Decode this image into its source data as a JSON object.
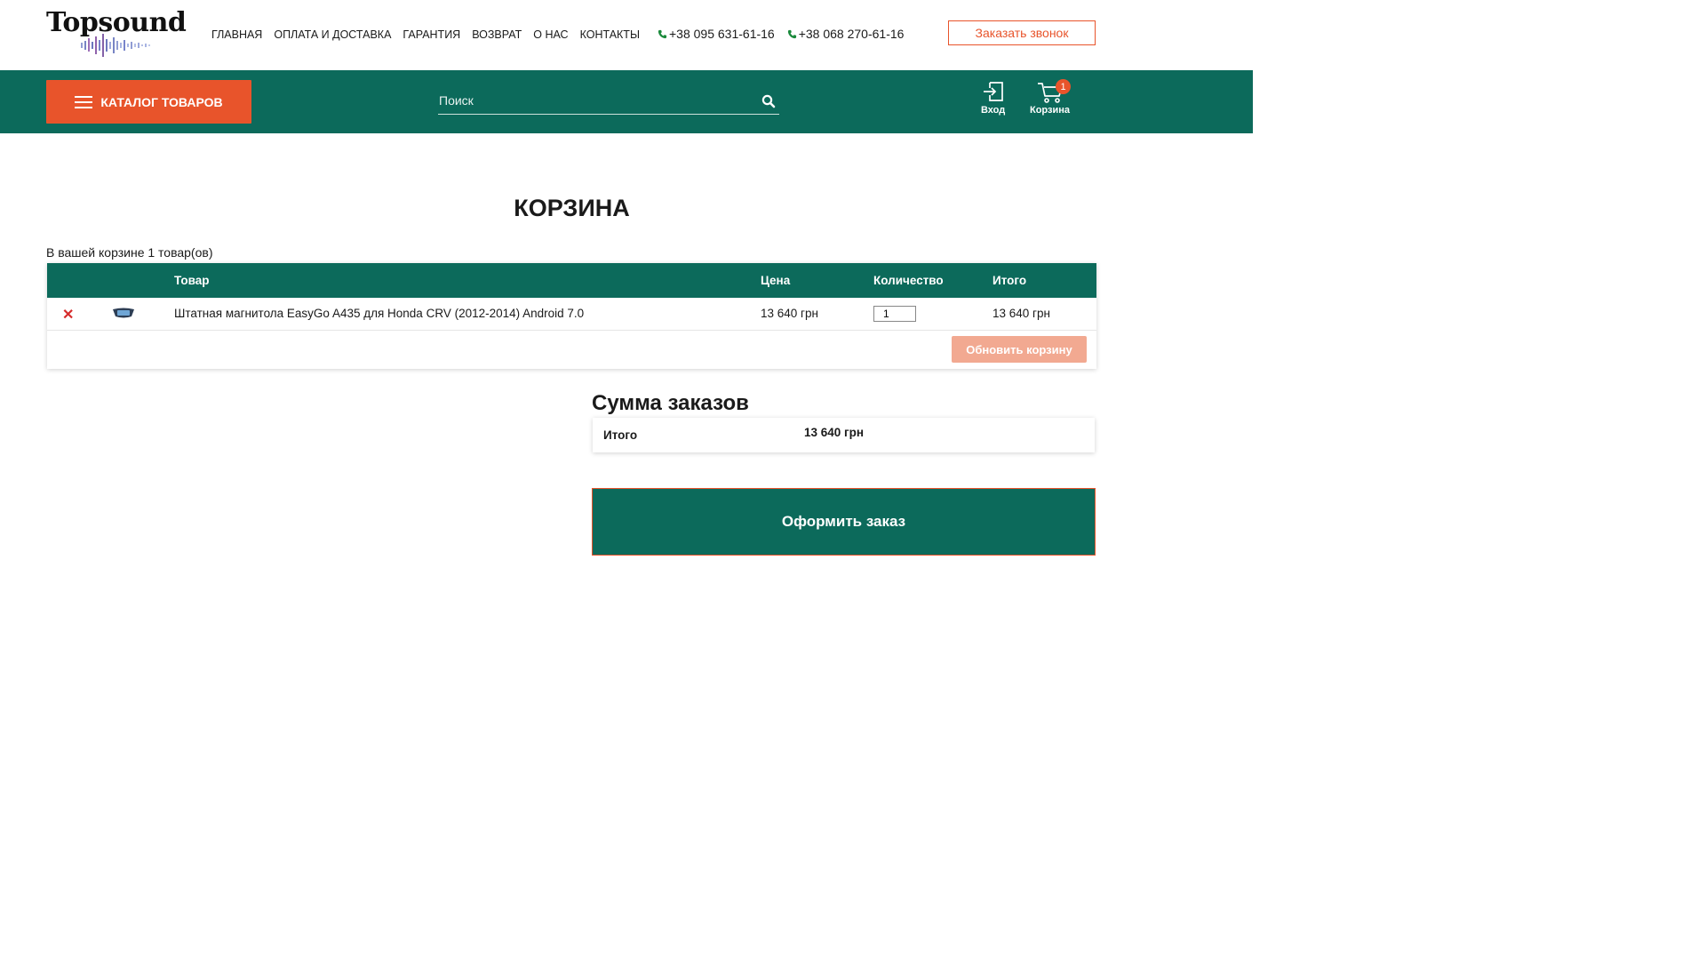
{
  "header": {
    "logo_text": "Topsound",
    "nav": [
      "ГЛАВНАЯ",
      "ОПЛАТА И ДОСТАВКА",
      "ГАРАНТИЯ",
      "ВОЗВРАТ",
      "О НАС",
      "КОНТАКТЫ"
    ],
    "phones": [
      "+38 095 631-61-16",
      "+38 068 270-61-16"
    ],
    "callback_label": "Заказать звонок"
  },
  "mainbar": {
    "catalog_label": "КАТАЛОГ ТОВАРОВ",
    "search_placeholder": "Поиск",
    "login_label": "Вход",
    "cart_label": "Корзина",
    "cart_count": "1"
  },
  "page": {
    "title": "КОРЗИНА",
    "count_note": "В вашей корзине 1 товар(ов)"
  },
  "cart_table": {
    "headers": {
      "product": "Товар",
      "price": "Цена",
      "quantity": "Количество",
      "total": "Итого"
    },
    "rows": [
      {
        "name": "Штатная магнитола EasyGo A435 для Honda CRV (2012-2014) Android 7.0",
        "price": "13 640  грн",
        "quantity": "1",
        "total": "13 640  грн"
      }
    ],
    "update_label": "Обновить корзину"
  },
  "summary": {
    "title": "Сумма заказов",
    "total_label": "Итого",
    "total_value": "13 640  грн"
  },
  "checkout_label": "Оформить заказ",
  "colors": {
    "brand_green": "#0c6a5b",
    "accent_orange": "#e8542b",
    "remove_red": "#d62b2b"
  }
}
